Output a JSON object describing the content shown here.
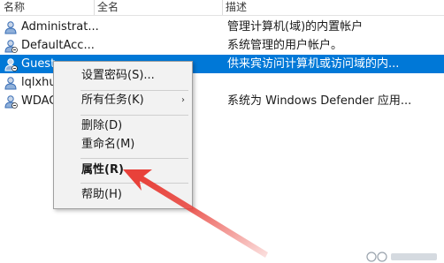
{
  "columns": {
    "name": "名称",
    "fullname": "全名",
    "description": "描述"
  },
  "rows": [
    {
      "name": "Administrat...",
      "description": "管理计算机(域)的内置帐户"
    },
    {
      "name": "DefaultAcc...",
      "description": "系统管理的用户帐户。"
    },
    {
      "name": "Guest",
      "description": "供来宾访问计算机或访问域的内..."
    },
    {
      "name": "lqlxhu",
      "description": ""
    },
    {
      "name": "WDAG",
      "description": "系统为 Windows Defender 应用..."
    }
  ],
  "selected_row": "Guest",
  "context_menu": {
    "set_password": "设置密码(S)...",
    "all_tasks": "所有任务(K)",
    "submenu_arrow": "›",
    "delete": "删除(D)",
    "rename": "重命名(M)",
    "properties": "属性(R)",
    "help": "帮助(H)"
  },
  "colors": {
    "selection": "#0078d7",
    "annotation_arrow": "#e8413a",
    "user_icon_blue": "#3b6fb6"
  },
  "icons": {
    "row_icon": "user-account-icon",
    "arrow": "red-annotation-arrow"
  }
}
